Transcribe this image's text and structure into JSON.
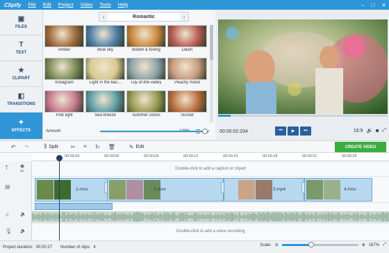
{
  "app": {
    "logo": "Clipify"
  },
  "menu": [
    "File",
    "Edit",
    "Project",
    "Video",
    "Tools",
    "Help"
  ],
  "window_controls": [
    "–",
    "□",
    "✕"
  ],
  "nav": [
    {
      "label": "FILES",
      "icon": "image-icon",
      "glyph": "▣"
    },
    {
      "label": "TEXT",
      "icon": "text-icon",
      "glyph": "T"
    },
    {
      "label": "CLIPART",
      "icon": "star-icon",
      "glyph": "★"
    },
    {
      "label": "TRANSITIONS",
      "icon": "transitions-icon",
      "glyph": "◧"
    },
    {
      "label": "EFFECTS",
      "icon": "magic-wand-icon",
      "glyph": "✦",
      "active": true
    }
  ],
  "effects": {
    "category": "Romantic",
    "items": [
      {
        "label": "Amber",
        "color": "#a06a3a"
      },
      {
        "label": "Blue sky",
        "color": "#4d7fa6"
      },
      {
        "label": "Bokeh & toning",
        "color": "#c9873d"
      },
      {
        "label": "Dawn",
        "color": "#b85b53"
      },
      {
        "label": "Instagram",
        "color": "#7d8e5a"
      },
      {
        "label": "Light in the bac...",
        "color": "#d9c98f"
      },
      {
        "label": "Lily-of-the-valley",
        "color": "#8fa2a8"
      },
      {
        "label": "Peachy mood",
        "color": "#c79a7c"
      },
      {
        "label": "Pink light",
        "color": "#c77a8e"
      },
      {
        "label": "Sea breeze",
        "color": "#5f9fa7"
      },
      {
        "label": "Summer colors",
        "color": "#9a9b52"
      },
      {
        "label": "Sunset",
        "color": "#b86e3a"
      }
    ],
    "amount_label": "Amount:",
    "amount_value": "100%",
    "amount_fraction": 1.0
  },
  "player": {
    "time": "00:00:02.034",
    "progress_fraction": 0.08,
    "aspect": "16:9",
    "buttons": [
      "prev",
      "play",
      "next"
    ]
  },
  "toolbar": {
    "split_label": "Split",
    "edit_label": "Edit",
    "create_label": "CREATE VIDEO"
  },
  "timeline": {
    "ticks": [
      "00:00:00",
      "00:00:03",
      "00:00:06",
      "00:00:09",
      "00:00:12",
      "00:00:15",
      "00:00:18",
      "00:00:21",
      "00:00:24"
    ],
    "caption_hint": "Double-click to add a caption or clipart",
    "voice_hint": "Double-click to add a voice recording",
    "clips": [
      {
        "label": "1.mov"
      },
      {
        "label": "2.mov"
      },
      {
        "label": "3.mp4"
      },
      {
        "label": "4.mov"
      }
    ],
    "transition_duration": "2.0"
  },
  "status": {
    "duration_label": "Project duration:",
    "duration_value": "00:00:27",
    "clips_label": "Number of clips:",
    "clips_value": "4",
    "scale_label": "Scale:",
    "scale_value": "167%"
  }
}
